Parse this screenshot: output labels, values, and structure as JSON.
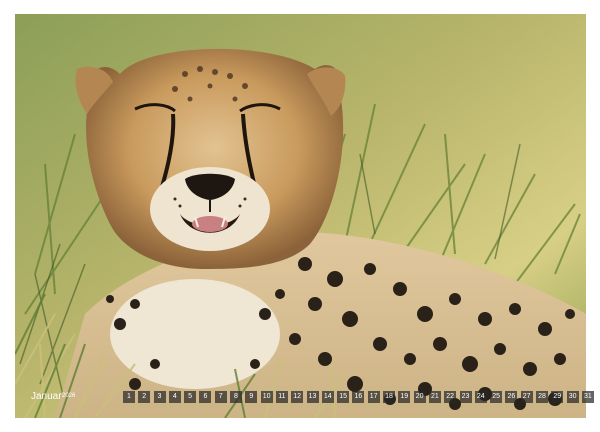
{
  "calendar": {
    "month": "Januar",
    "year": "2026",
    "days": [
      "",
      "",
      "",
      "1",
      "2",
      "3",
      "4",
      "5",
      "6",
      "7",
      "8",
      "9",
      "10",
      "11",
      "12",
      "13",
      "14",
      "15",
      "16",
      "17",
      "18",
      "19",
      "20",
      "21",
      "22",
      "23",
      "24",
      "25",
      "26",
      "27",
      "28",
      "29",
      "30",
      "31"
    ]
  },
  "photo": {
    "subject": "cheetah-portrait",
    "colors": {
      "fur": "#c89a5e",
      "grass_light": "#c9c37c",
      "grass_dark": "#4c6a2c",
      "sky": "#d7cf86"
    }
  }
}
